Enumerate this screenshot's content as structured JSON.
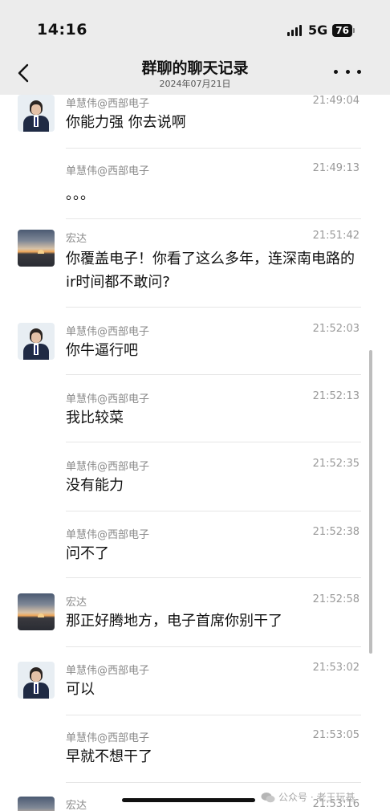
{
  "status_bar": {
    "time": "14:16",
    "network": "5G",
    "battery": "76"
  },
  "nav": {
    "title": "群聊的聊天记录",
    "subtitle": "2024年07月21日"
  },
  "messages": [
    {
      "sender": "单慧伟@西部电子",
      "time": "21:49:04",
      "text": "你能力强 你去说啊",
      "avatar": "man-suit"
    },
    {
      "sender": "单慧伟@西部电子",
      "time": "21:49:13",
      "text": "。。。",
      "avatar": ""
    },
    {
      "sender": "宏达",
      "time": "21:51:42",
      "text": "你覆盖电子！你看了这么多年，连深南电路的ir时间都不敢问?",
      "avatar": "sunset"
    },
    {
      "sender": "单慧伟@西部电子",
      "time": "21:52:03",
      "text": "你牛逼行吧",
      "avatar": "man-suit"
    },
    {
      "sender": "单慧伟@西部电子",
      "time": "21:52:13",
      "text": "我比较菜",
      "avatar": ""
    },
    {
      "sender": "单慧伟@西部电子",
      "time": "21:52:35",
      "text": "没有能力",
      "avatar": ""
    },
    {
      "sender": "单慧伟@西部电子",
      "time": "21:52:38",
      "text": "问不了",
      "avatar": ""
    },
    {
      "sender": "宏达",
      "time": "21:52:58",
      "text": "那正好腾地方，电子首席你别干了",
      "avatar": "sunset"
    },
    {
      "sender": "单慧伟@西部电子",
      "time": "21:53:02",
      "text": "可以",
      "avatar": "man-suit"
    },
    {
      "sender": "单慧伟@西部电子",
      "time": "21:53:05",
      "text": "早就不想干了",
      "avatar": ""
    },
    {
      "sender": "宏达",
      "time": "21:53:16",
      "text": "",
      "avatar": "sunset"
    }
  ],
  "watermark": {
    "text": "公众号 · 老王玩基"
  },
  "colors": {
    "header_bg": "#ececec",
    "divider": "#e6e6e6",
    "secondary_text": "#8a8a8a"
  },
  "icons": {
    "back": "chevron-left-icon",
    "more": "more-dots-icon",
    "signal": "signal-icon",
    "watermark": "wechat-icon"
  }
}
